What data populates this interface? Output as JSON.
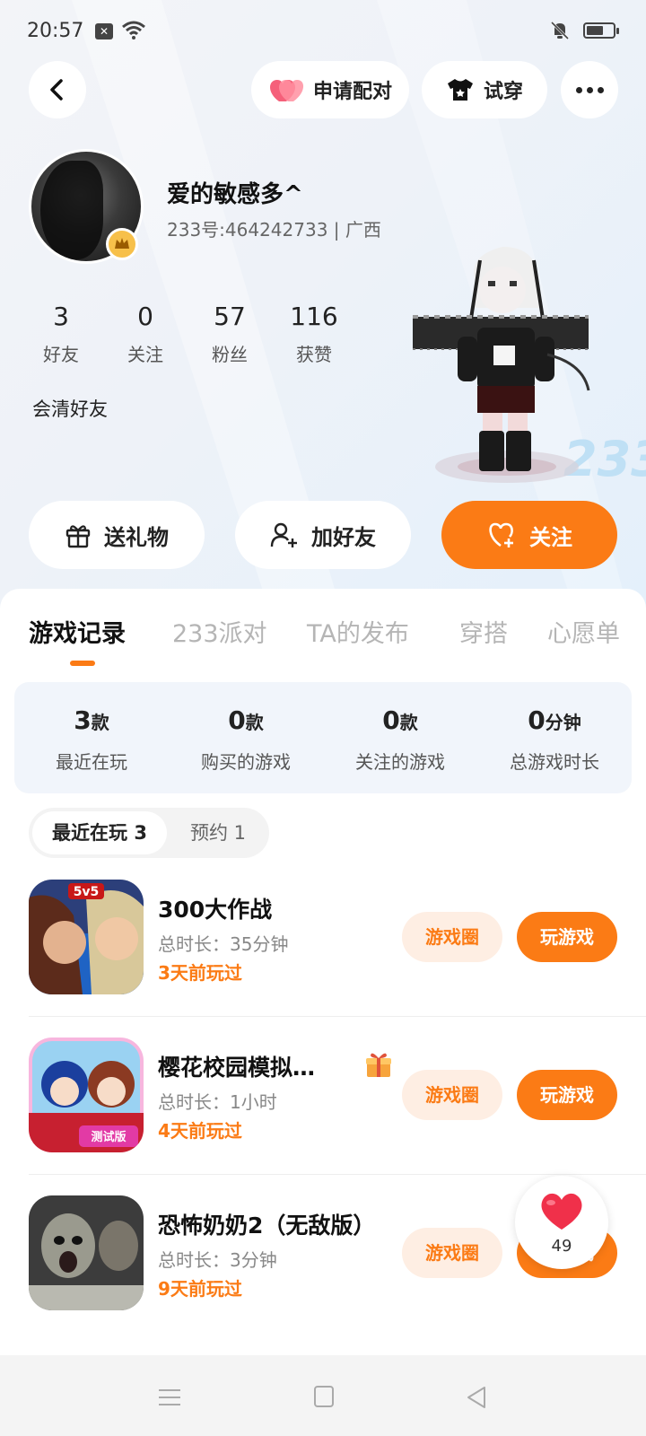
{
  "status_bar": {
    "time": "20:57",
    "notif_badge": "✕"
  },
  "header": {
    "pair_label": "申请配对",
    "try_label": "试穿"
  },
  "profile": {
    "username": "爱的敏感多^",
    "uid_line": "233号:464242733 | 广西",
    "bio": "会清好友",
    "stats": [
      {
        "value": "3",
        "label": "好友"
      },
      {
        "value": "0",
        "label": "关注"
      },
      {
        "value": "57",
        "label": "粉丝"
      },
      {
        "value": "116",
        "label": "获赞"
      }
    ],
    "badge_text": "233"
  },
  "actions": {
    "gift_label": "送礼物",
    "add_friend_label": "加好友",
    "follow_label": "关注"
  },
  "tabs": [
    "游戏记录",
    "233派对",
    "TA的发布",
    "穿搭",
    "心愿单"
  ],
  "summary": [
    {
      "value": "3",
      "unit": "款",
      "label": "最近在玩"
    },
    {
      "value": "0",
      "unit": "款",
      "label": "购买的游戏"
    },
    {
      "value": "0",
      "unit": "款",
      "label": "关注的游戏"
    },
    {
      "value": "0",
      "unit": "分钟",
      "label": "总游戏时长"
    }
  ],
  "subtabs": {
    "recent": "最近在玩 3",
    "reserved": "预约 1"
  },
  "games": [
    {
      "name": "300大作战",
      "duration": "总时长：35分钟",
      "last_played": "3天前玩过",
      "icon_badge": "5v5",
      "circle_label": "游戏圈",
      "play_label": "玩游戏"
    },
    {
      "name": "樱花校园模拟…",
      "duration": "总时长：1小时",
      "last_played": "4天前玩过",
      "icon_badge": "测试版",
      "circle_label": "游戏圈",
      "play_label": "玩游戏"
    },
    {
      "name": "恐怖奶奶2（无敌版）",
      "duration": "总时长：3分钟",
      "last_played": "9天前玩过",
      "icon_badge": "",
      "circle_label": "游戏圈",
      "play_label": "玩游戏"
    }
  ],
  "likes": {
    "count": "49"
  },
  "colors": {
    "accent": "#fb7b15",
    "accent_light": "#feeee3",
    "heart": "#f0304a",
    "crown": "#f7c04a"
  }
}
